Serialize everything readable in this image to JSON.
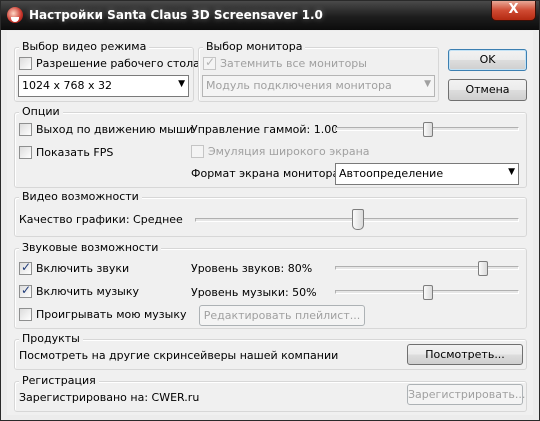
{
  "window": {
    "title": "Настройки Santa Claus 3D Screensaver 1.0",
    "close_label": "X"
  },
  "video_mode": {
    "group_label": "Выбор видео режима",
    "desktop_resolution_label": "Разрешение рабочего стола",
    "desktop_resolution_checked": false,
    "resolution_value": "1024 x 768 x 32"
  },
  "monitor": {
    "group_label": "Выбор монитора",
    "darken_all_label": "Затемнить все мониторы",
    "darken_all_checked": true,
    "module_value": "Модуль подключения монитора"
  },
  "buttons": {
    "ok": "OK",
    "cancel": "Отмена"
  },
  "options": {
    "group_label": "Опции",
    "exit_on_mouse_label": "Выход по движению мыши",
    "exit_on_mouse_checked": false,
    "show_fps_label": "Показать FPS",
    "show_fps_checked": false,
    "gamma_label": "Управление гаммой: 1.00",
    "gamma_level": 0.5,
    "widescreen_label": "Эмуляция широкого экрана",
    "widescreen_checked": false,
    "screen_format_label": "Формат экрана монитора:",
    "screen_format_value": "Автоопределение"
  },
  "video_caps": {
    "group_label": "Видео возможности",
    "quality_label": "Качество графики: Среднее",
    "quality_level": 0.5
  },
  "sound": {
    "group_label": "Звуковые возможности",
    "enable_sounds_label": "Включить звуки",
    "enable_sounds_checked": true,
    "enable_music_label": "Включить музыку",
    "enable_music_checked": true,
    "play_my_music_label": "Проигрывать мою музыку",
    "play_my_music_checked": false,
    "sound_level_label": "Уровень звуков: 80%",
    "sound_level": 0.8,
    "music_level_label": "Уровень музыки: 50%",
    "music_level": 0.5,
    "edit_playlist_label": "Редактировать плейлист..."
  },
  "products": {
    "group_label": "Продукты",
    "text": "Посмотреть на другие скринсейверы нашей компании",
    "view_label": "Посмотреть..."
  },
  "registration": {
    "group_label": "Регистрация",
    "text": "Зарегистрировано на: CWER.ru",
    "register_label": "Зарегистрировать..."
  },
  "icons": {
    "check": "check-mark-icon",
    "dropdown": "dropdown-arrow-icon",
    "app": "santa-app-icon"
  }
}
